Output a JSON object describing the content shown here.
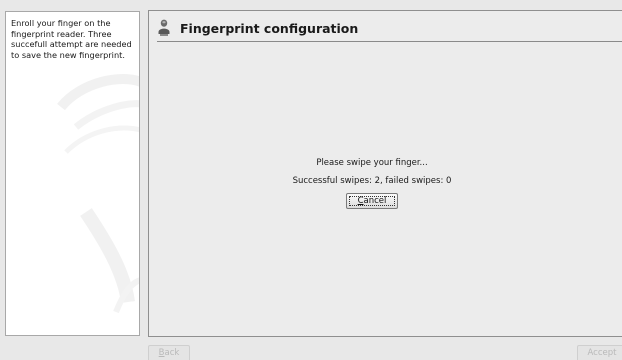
{
  "help": {
    "text": "Enroll your finger on the fingerprint reader. Three succefull attempt are needed to save the new fingerprint."
  },
  "header": {
    "icon": "fingerprint-user-icon",
    "title": "Fingerprint configuration"
  },
  "status": {
    "prompt": "Please swipe your finger...",
    "counts": "Successful swipes: 2, failed swipes: 0"
  },
  "buttons": {
    "cancel_mnemonic": "C",
    "cancel_rest": "ancel",
    "back_mnemonic": "B",
    "back_rest": "ack",
    "accept_label": "Accept"
  }
}
